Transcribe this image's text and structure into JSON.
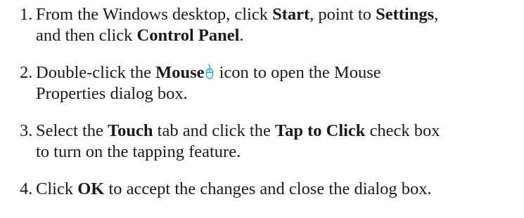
{
  "steps": [
    {
      "number": "1.",
      "line1": {
        "t1": "From the Windows desktop, click ",
        "b1": "Start",
        "t2": ", point to ",
        "b2": "Settings",
        "t3": ","
      },
      "line2": {
        "t1": "and then click ",
        "b1": "Control Panel",
        "t2": "."
      }
    },
    {
      "number": "2.",
      "line1": {
        "t1": "Double-click the ",
        "b1": "Mouse",
        "icon": "mouse-icon",
        "t2": " icon to open the Mouse"
      },
      "line2": {
        "t1": "Properties dialog box."
      }
    },
    {
      "number": "3.",
      "line1": {
        "t1": "Select the ",
        "b1": "Touch",
        "t2": " tab and click the ",
        "b2": "Tap to Click",
        "t3": " check box"
      },
      "line2": {
        "t1": "to turn on the tapping feature."
      }
    },
    {
      "number": "4.",
      "line1": {
        "t1": "Click ",
        "b1": "OK",
        "t2": " to accept the changes and close the dialog box."
      }
    }
  ],
  "colors": {
    "text": "#1a1a1a",
    "icon": "#2a9fd8"
  }
}
